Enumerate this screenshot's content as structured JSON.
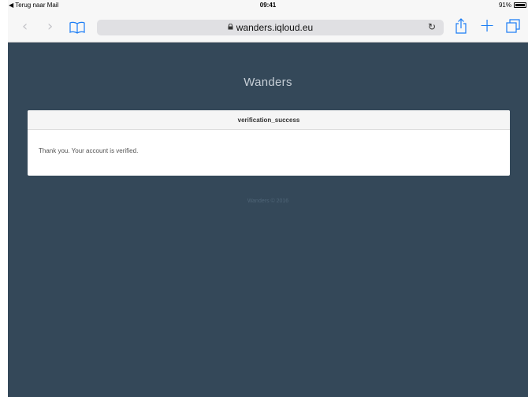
{
  "status_bar": {
    "back_label": "◀ Terug naar Mail",
    "time": "09:41",
    "battery": "91%"
  },
  "browser": {
    "url": "wanders.iqloud.eu",
    "icons": [
      "back-icon",
      "forward-icon",
      "bookmarks-icon",
      "lock-icon",
      "reload-icon",
      "share-icon",
      "new-tab-icon",
      "tabs-icon"
    ],
    "accent_color": "#1a7cf5"
  },
  "page": {
    "site_title": "Wanders",
    "panel_heading": "verification_success",
    "panel_message": "Thank you. Your account is verified.",
    "footer": "Wanders © 2016",
    "background_color": "#344859"
  }
}
